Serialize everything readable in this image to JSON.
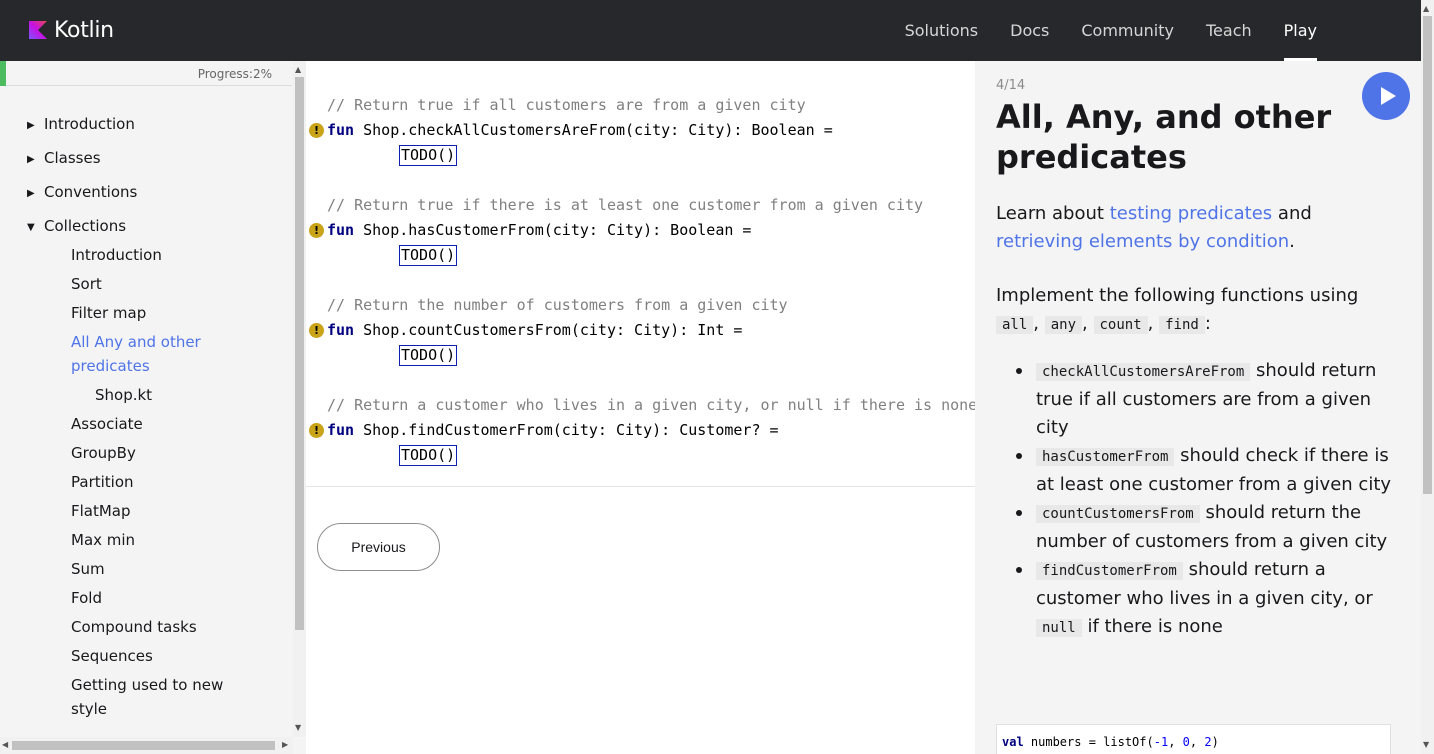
{
  "header": {
    "logo_text": "Kotlin",
    "nav": [
      "Solutions",
      "Docs",
      "Community",
      "Teach",
      "Play"
    ],
    "active_nav": "Play"
  },
  "sidebar": {
    "progress_text": "Progress:2%",
    "progress_fraction": 0.02,
    "items": [
      {
        "label": "Introduction",
        "level": 0,
        "caret": "right"
      },
      {
        "label": "Classes",
        "level": 0,
        "caret": "right"
      },
      {
        "label": "Conventions",
        "level": 0,
        "caret": "right"
      },
      {
        "label": "Collections",
        "level": 0,
        "caret": "down"
      },
      {
        "label": "Introduction",
        "level": 1
      },
      {
        "label": "Sort",
        "level": 1
      },
      {
        "label": "Filter map",
        "level": 1
      },
      {
        "label": "All Any and other predicates",
        "level": 1,
        "active": true
      },
      {
        "label": "Shop.kt",
        "level": 2
      },
      {
        "label": "Associate",
        "level": 1
      },
      {
        "label": "GroupBy",
        "level": 1
      },
      {
        "label": "Partition",
        "level": 1
      },
      {
        "label": "FlatMap",
        "level": 1
      },
      {
        "label": "Max min",
        "level": 1
      },
      {
        "label": "Sum",
        "level": 1
      },
      {
        "label": "Fold",
        "level": 1
      },
      {
        "label": "Compound tasks",
        "level": 1
      },
      {
        "label": "Sequences",
        "level": 1
      },
      {
        "label": "Getting used to new style",
        "level": 1
      }
    ]
  },
  "editor": {
    "blocks": [
      {
        "comment": "// Return true if all customers are from a given city",
        "keyword": "fun",
        "signature": " Shop.checkAllCustomersAreFrom(city: City): Boolean =",
        "body": "TODO()"
      },
      {
        "comment": "// Return true if there is at least one customer from a given city",
        "keyword": "fun",
        "signature": " Shop.hasCustomerFrom(city: City): Boolean =",
        "body": "TODO()"
      },
      {
        "comment": "// Return the number of customers from a given city",
        "keyword": "fun",
        "signature": " Shop.countCustomersFrom(city: City): Int =",
        "body": "TODO()"
      },
      {
        "comment": "// Return a customer who lives in a given city, or null if there is none",
        "keyword": "fun",
        "signature": " Shop.findCustomerFrom(city: City): Customer? =",
        "body": "TODO()"
      }
    ],
    "warning_glyph": "!",
    "previous_label": "Previous"
  },
  "panel": {
    "step": "4/14",
    "title": "All, Any, and other predicates",
    "intro_prefix": "Learn about ",
    "link1": "testing predicates",
    "intro_mid": " and ",
    "link2": "retrieving elements by condition",
    "intro_suffix": ".",
    "impl_text": "Implement the following functions using",
    "fn_codes": [
      "all",
      "any",
      "count",
      "find"
    ],
    "bullets": [
      {
        "code": "checkAllCustomersAreFrom",
        "text": " should return true if all customers are from a given city"
      },
      {
        "code": "hasCustomerFrom",
        "text": " should check if there is at least one customer from a given city"
      },
      {
        "code": "countCustomersFrom",
        "text": " should return the number of customers from a given city"
      },
      {
        "code": "findCustomerFrom",
        "text": " should return a customer who lives in a given city, or ",
        "code2": "null",
        "text2": " if there is none"
      }
    ],
    "snippet": {
      "kw": "val",
      "rest": " numbers = listOf(",
      "n1": "-1",
      "sep1": ", ",
      "n2": "0",
      "sep2": ", ",
      "n3": "2",
      "close": ")"
    }
  },
  "colors": {
    "header_bg": "#27282c",
    "accent": "#4f74e8",
    "progress": "#4dbb5f",
    "warning": "#c9a318"
  }
}
